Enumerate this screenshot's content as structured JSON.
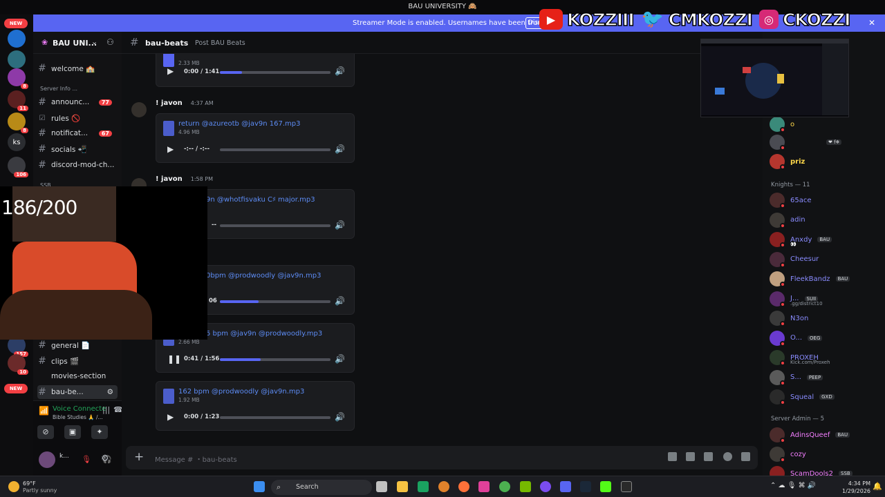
{
  "titlebar": {
    "title": "BAU UNIVERSITY 🙈"
  },
  "banner": {
    "message": "Streamer Mode is enabled. Usernames have been truncated.",
    "disable_label": "Disa"
  },
  "overlay": {
    "youtube": "KOZZIII",
    "twitter": "CMKOZZI",
    "instagram": "CKOZZI"
  },
  "server_rail": {
    "new_top": "NEW",
    "new_bottom": "NEW",
    "ks_label": "ks",
    "badges": [
      "8",
      "11",
      "8",
      "106",
      "157",
      "10"
    ]
  },
  "server": {
    "name": "BAU UNI..."
  },
  "channels": [
    {
      "label": "welcome 🏫",
      "icon": "#",
      "badge": ""
    },
    {
      "label": "announc...",
      "icon": "#",
      "badge": "77"
    },
    {
      "label": "rules 🚫",
      "icon": "☑",
      "badge": ""
    },
    {
      "label": "notificat...",
      "icon": "#",
      "badge": "67"
    },
    {
      "label": "socials 📲",
      "icon": "#",
      "badge": ""
    },
    {
      "label": "discord-mod-ch...",
      "icon": "#",
      "badge": ""
    },
    {
      "label": "general 📄",
      "icon": "#",
      "badge": ""
    },
    {
      "label": "clips 🎬",
      "icon": "#",
      "badge": ""
    },
    {
      "label": "movies-section",
      "icon": "#",
      "badge": ""
    },
    {
      "label": "bau-be...",
      "icon": "#",
      "badge": ""
    }
  ],
  "categories": {
    "server_info": "Server Info ...",
    "ssb": "SSB"
  },
  "voice": {
    "status": "Voice Connecte",
    "channel": "Bible Studies 🙏 /...",
    "user": "k..."
  },
  "webcam": {
    "counter": "186/200"
  },
  "header": {
    "channel": "bau-beats",
    "topic": "Post BAU Beats"
  },
  "messages": [
    {
      "author": "! javon",
      "time": "4:37 AM"
    },
    {
      "author": "! javon",
      "time": "1:58 PM"
    }
  ],
  "attachments": [
    {
      "name": "",
      "size": "2.33 MB",
      "time": "0:00 / 1:41",
      "progress": 0.2,
      "playing": false
    },
    {
      "name": "return @azureotb @jav9n 167.mp3",
      "size": "4.96 MB",
      "time": "-:-- / -:--",
      "progress": 0.0,
      "playing": false
    },
    {
      "name": "9n @whotfisvaku C♯ major.mp3",
      "size": "",
      "time": "--",
      "progress": 0.0,
      "playing": false
    },
    {
      "name": "0bpm @prodwoodly @jav9n.mp3",
      "size": "",
      "time": "06",
      "progress": 0.35,
      "playing": false
    },
    {
      "name": "5 bpm @jav9n @prodwoodly.mp3",
      "size": "2.66 MB",
      "time": "0:41 / 1:56",
      "progress": 0.37,
      "playing": true
    },
    {
      "name": "162 bpm @prodwoodly @jav9n.mp3",
      "size": "1.92 MB",
      "time": "0:00 / 1:23",
      "progress": 0.0,
      "playing": false
    }
  ],
  "composer": {
    "placeholder": "Message # ・bau-beats"
  },
  "members": {
    "top": [
      {
        "name": "o",
        "tag": ""
      },
      {
        "name": "",
        "tag": "❤ f❄"
      },
      {
        "name": "priz",
        "tag": ""
      }
    ],
    "knights_header": "Knights — 11",
    "knights": [
      {
        "name": "65ace",
        "tag": "",
        "sub": ""
      },
      {
        "name": "adin",
        "tag": "",
        "sub": ""
      },
      {
        "name": "Anxdy",
        "tag": "BAU",
        "sub": "👀"
      },
      {
        "name": "Cheesur",
        "tag": "",
        "sub": ""
      },
      {
        "name": "FleekBandz",
        "tag": "BAU",
        "sub": ""
      },
      {
        "name": "J...",
        "tag": "SUII",
        "sub": ".gg/district10"
      },
      {
        "name": "N3on",
        "tag": "",
        "sub": ""
      },
      {
        "name": "O...",
        "tag": "OEG",
        "sub": ""
      },
      {
        "name": "PROXEH",
        "tag": "",
        "sub": "Kick.com/Proxeh"
      },
      {
        "name": "S...",
        "tag": "PEEP",
        "sub": ""
      },
      {
        "name": "Squeal",
        "tag": "GXD",
        "sub": ""
      }
    ],
    "admin_header": "Server Admin — 5",
    "admins": [
      {
        "name": "AdinsQueef",
        "tag": "BAU"
      },
      {
        "name": "cozy",
        "tag": ""
      },
      {
        "name": "ScamDools2",
        "tag": "SSB"
      }
    ]
  },
  "taskbar": {
    "weather_temp": "69°F",
    "weather_desc": "Partly sunny",
    "search": "Search",
    "time": "4:34 PM",
    "date": "1/29/2026"
  },
  "colors": {
    "banner": "#5865f2",
    "link": "#5d8cf5",
    "badge": "#f23f43",
    "knight_name": "#8a8cff",
    "admin_name": "#f47fff"
  }
}
